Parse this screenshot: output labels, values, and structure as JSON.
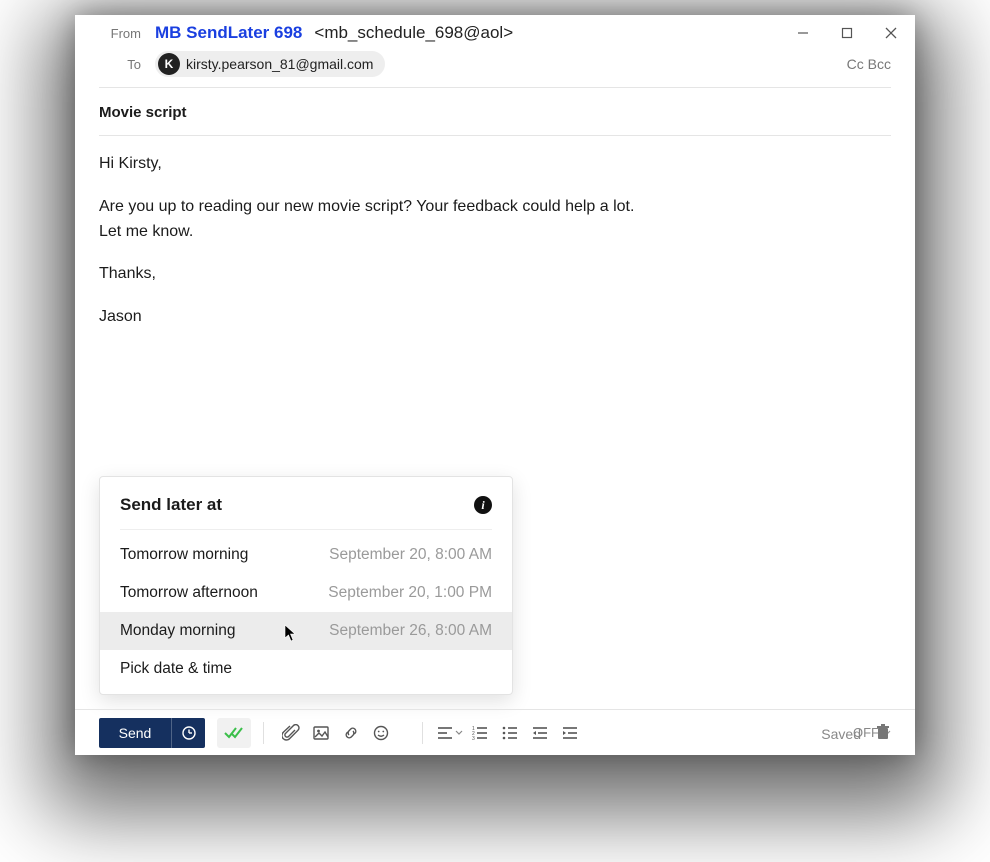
{
  "header": {
    "from_label": "From",
    "from_name": "MB SendLater 698",
    "from_addr": "<mb_schedule_698@aol>",
    "to_label": "To",
    "to_chip_initial": "K",
    "to_chip_email": "kirsty.pearson_81@gmail.com",
    "ccbcc": "Cc Bcc"
  },
  "subject": "Movie script",
  "body": {
    "greeting": "Hi Kirsty,",
    "para1": "Are you up to reading our new movie script? Your feedback could help a lot.\nLet me know.",
    "thanks": "Thanks,",
    "sign": "Jason"
  },
  "popup": {
    "title": "Send later at",
    "items": [
      {
        "label": "Tomorrow morning",
        "when": "September 20, 8:00 AM"
      },
      {
        "label": "Tomorrow afternoon",
        "when": "September 20, 1:00 PM"
      },
      {
        "label": "Monday morning",
        "when": "September 26, 8:00 AM"
      }
    ],
    "pick_label": "Pick date & time"
  },
  "toolbar": {
    "send_label": "Send",
    "saved_label": "Saved",
    "off_label": "OFF"
  }
}
